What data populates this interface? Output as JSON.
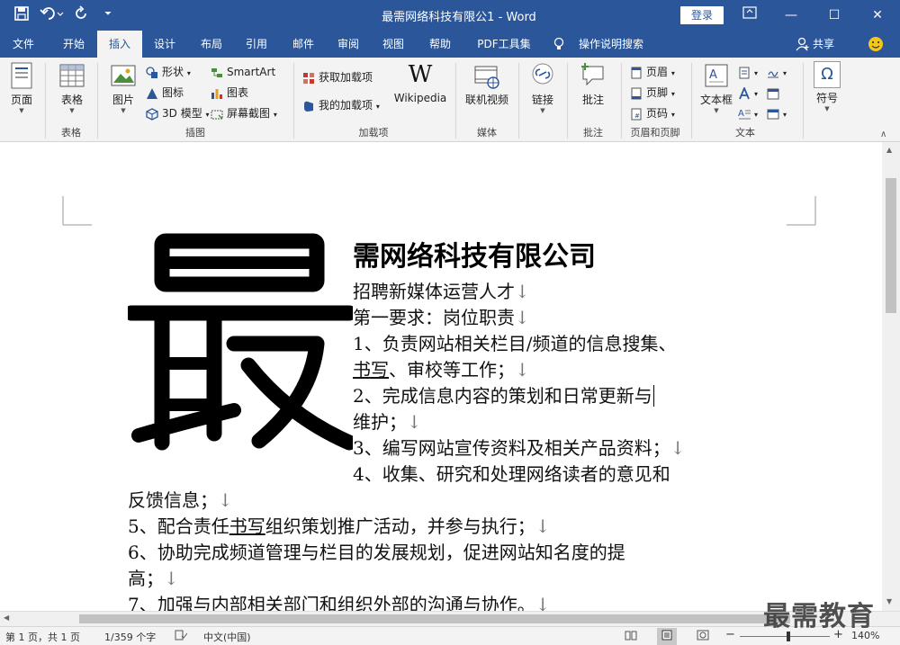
{
  "titlebar": {
    "title": "最需网络科技有限公1 - Word",
    "login": "登录"
  },
  "tabs": [
    "文件",
    "开始",
    "插入",
    "设计",
    "布局",
    "引用",
    "邮件",
    "审阅",
    "视图",
    "帮助",
    "PDF工具集"
  ],
  "tellme": "操作说明搜索",
  "share": "共享",
  "ribbon": {
    "pages": "页面",
    "table": "表格",
    "picture": "图片",
    "shapes": "形状",
    "icons": "图标",
    "model3d": "3D 模型",
    "smartart": "SmartArt",
    "chart": "图表",
    "screenshot": "屏幕截图",
    "get_addins": "获取加载项",
    "my_addins": "我的加载项",
    "wikipedia": "Wikipedia",
    "online_video": "联机视频",
    "link": "链接",
    "comment": "批注",
    "header": "页眉",
    "footer": "页脚",
    "page_number": "页码",
    "textbox": "文本框",
    "symbol": "符号",
    "groups": {
      "table": "表格",
      "illustrations": "插图",
      "addins": "加载项",
      "media": "媒体",
      "comments": "批注",
      "header_footer": "页眉和页脚",
      "text": "文本"
    }
  },
  "doc": {
    "company": "需网络科技有限公司",
    "lines": [
      "招聘新媒体运营人才",
      "第一要求：岗位职责",
      "1、负责网站相关栏目/频道的信息搜集、",
      "书写、审校等工作；",
      "2、完成信息内容的策划和日常更新与",
      "维护；",
      "3、编写网站宣传资料及相关产品资料；",
      "4、收集、研究和处理网络读者的意见和",
      "反馈信息；",
      "5、配合责任书写组织策划推广活动，并参与执行；",
      "6、协助完成频道管理与栏目的发展规划，促进网站知名度的提",
      "高；",
      "7、加强与内部相关部门和组织外部的沟通与协作。"
    ],
    "paragraph_mark": "↓"
  },
  "status": {
    "page": "第 1 页，共 1 页",
    "words": "1/359 个字",
    "lang": "中文(中国)",
    "zoom": "140%"
  },
  "watermark": "最需教育",
  "colors": {
    "accent": "#2b579a"
  }
}
